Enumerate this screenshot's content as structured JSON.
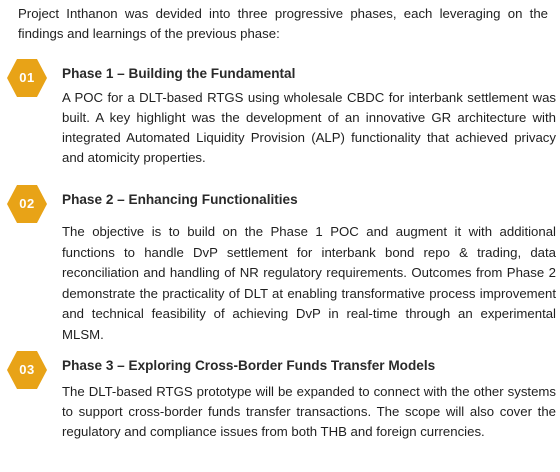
{
  "intro": "Project Inthanon was devided into three progressive phases, each leveraging on the findings and learnings of the previous phase:",
  "accent_color": "#e8a317",
  "phases": [
    {
      "number": "01",
      "title": "Phase 1 – Building the Fundamental",
      "body": "A POC for a DLT-based RTGS using wholesale CBDC for interbank settlement was built. A key highlight was the development of an innovative GR architecture with integrated Automated Liquidity Provision (ALP) functionality that achieved privacy and atomicity properties."
    },
    {
      "number": "02",
      "title": "Phase 2 – Enhancing Functionalities",
      "body": "The objective is to build on the Phase 1 POC and augment it with additional functions to handle DvP settlement for interbank bond repo & trading, data reconciliation and handling of NR regulatory requirements. Outcomes from Phase 2 demonstrate the practicality of DLT at enabling transformative process improvement and technical feasibility of achieving DvP in real-time through an experimental MLSM."
    },
    {
      "number": "03",
      "title": "Phase 3 – Exploring Cross-Border Funds Transfer Models",
      "body": "The DLT-based RTGS prototype will be expanded to connect with the other systems to support cross-border funds transfer transactions. The scope will also cover the regulatory and compliance issues from both THB and foreign currencies."
    }
  ]
}
